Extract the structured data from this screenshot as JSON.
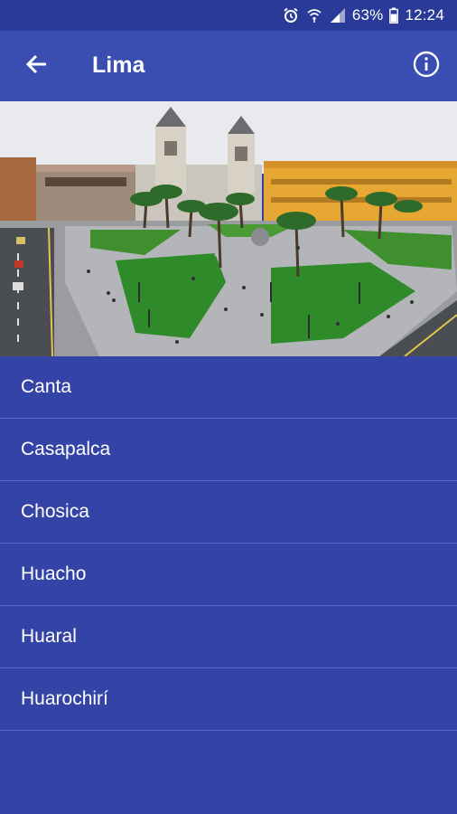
{
  "status": {
    "battery_percent": "63%",
    "time": "12:24",
    "icons": [
      "alarm-icon",
      "wifi-icon",
      "signal-icon",
      "battery-icon"
    ]
  },
  "app_bar": {
    "title": "Lima",
    "back_icon": "arrow-left-icon",
    "info_icon": "info-icon"
  },
  "hero": {
    "image": "plaza-de-armas-photo"
  },
  "list": {
    "items": [
      {
        "label": "Canta"
      },
      {
        "label": "Casapalca"
      },
      {
        "label": "Chosica"
      },
      {
        "label": "Huacho"
      },
      {
        "label": "Huaral"
      },
      {
        "label": "Huarochirí"
      }
    ]
  },
  "colors": {
    "background": "#3444a6",
    "app_bar": "#3a4db1",
    "status_bar": "#2a3a98",
    "divider": "#5565c0"
  }
}
